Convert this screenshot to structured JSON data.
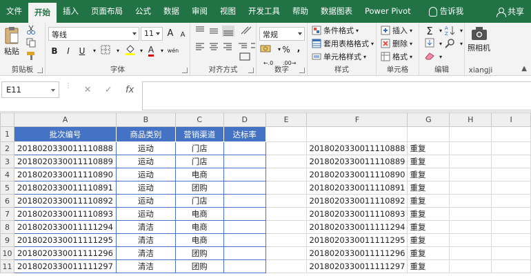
{
  "tabs": [
    "文件",
    "开始",
    "插入",
    "页面布局",
    "公式",
    "数据",
    "审阅",
    "视图",
    "开发工具",
    "帮助",
    "数据图表",
    "Power Pivot"
  ],
  "active_tab": "开始",
  "tell_me": "告诉我",
  "share": "共享",
  "ribbon": {
    "clipboard": {
      "paste": "粘贴",
      "label": "剪贴板"
    },
    "font": {
      "name": "等线",
      "size": "11",
      "label": "字体",
      "bold": "B",
      "italic": "I",
      "underline": "U",
      "grow": "A",
      "shrink": "A",
      "font_color": "A",
      "wen": "wén"
    },
    "alignment": {
      "label": "对齐方式"
    },
    "number": {
      "format": "常规",
      "label": "数字",
      "percent": "%",
      "comma": ","
    },
    "styles": {
      "conditional": "条件格式",
      "table": "套用表格格式",
      "cell": "单元格样式",
      "label": "样式"
    },
    "cells": {
      "insert": "插入",
      "delete": "删除",
      "format": "格式",
      "label": "单元格"
    },
    "editing": {
      "label": "编辑"
    },
    "camera": {
      "btn": "照相机",
      "label": "xiangji"
    }
  },
  "formula_bar": {
    "name_box": "E11",
    "fx": "fx",
    "cancel": "✕",
    "enter": "✓"
  },
  "columns": [
    "A",
    "B",
    "C",
    "D",
    "E",
    "F",
    "G",
    "H",
    "I"
  ],
  "table_header": [
    "批次编号",
    "商品类别",
    "营销渠道",
    "达标率"
  ],
  "rows": [
    {
      "num": "1"
    },
    {
      "num": "2",
      "a": "2018020330011110888",
      "b": "运动",
      "c": "门店",
      "f": "2018020330011110888",
      "g": "重复"
    },
    {
      "num": "3",
      "a": "2018020330011110889",
      "b": "运动",
      "c": "门店",
      "f": "2018020330011110889",
      "g": "重复"
    },
    {
      "num": "4",
      "a": "2018020330011110890",
      "b": "运动",
      "c": "电商",
      "f": "2018020330011110890",
      "g": "重复"
    },
    {
      "num": "5",
      "a": "2018020330011110891",
      "b": "运动",
      "c": "团购",
      "f": "2018020330011110891",
      "g": "重复"
    },
    {
      "num": "6",
      "a": "2018020330011110892",
      "b": "运动",
      "c": "门店",
      "f": "2018020330011110892",
      "g": "重复"
    },
    {
      "num": "7",
      "a": "2018020330011110893",
      "b": "运动",
      "c": "电商",
      "f": "2018020330011110893",
      "g": "重复"
    },
    {
      "num": "8",
      "a": "2018020330011111294",
      "b": "清洁",
      "c": "电商",
      "f": "2018020330011111294",
      "g": "重复"
    },
    {
      "num": "9",
      "a": "2018020330011111295",
      "b": "清洁",
      "c": "电商",
      "f": "2018020330011111295",
      "g": "重复"
    },
    {
      "num": "10",
      "a": "2018020330011111296",
      "b": "清洁",
      "c": "团购",
      "f": "2018020330011111296",
      "g": "重复"
    },
    {
      "num": "11",
      "a": "2018020330011111297",
      "b": "清洁",
      "c": "团购",
      "f": "2018020330011111297",
      "g": "重复"
    }
  ],
  "colors": {
    "accent": "#217346",
    "table_header": "#4472c4"
  }
}
